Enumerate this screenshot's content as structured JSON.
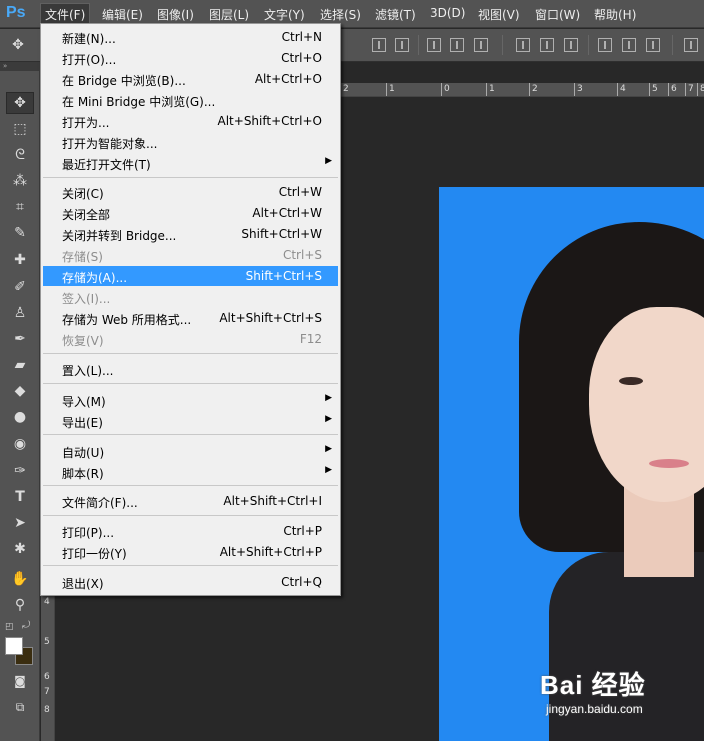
{
  "menubar": {
    "logo": "Ps",
    "items": [
      "文件(F)",
      "编辑(E)",
      "图像(I)",
      "图层(L)",
      "文字(Y)",
      "选择(S)",
      "滤镜(T)",
      "3D(D)",
      "视图(V)",
      "窗口(W)",
      "帮助(H)"
    ]
  },
  "toolbar": {
    "collapse": "»",
    "tools": [
      "move-tool",
      "marquee-tool",
      "lasso-tool",
      "magic-wand-tool",
      "crop-tool",
      "eyedropper-tool",
      "healing-brush-tool",
      "brush-tool",
      "clone-stamp-tool",
      "history-brush-tool",
      "eraser-tool",
      "paint-bucket-tool",
      "blur-tool",
      "dodge-tool",
      "pen-tool",
      "type-tool",
      "path-selection-tool",
      "shape-tool",
      "hand-tool",
      "zoom-tool"
    ],
    "foreground_color": "#ffffff",
    "background_color": "#3a2d10"
  },
  "rulers": {
    "top": [
      "2",
      "1",
      "0",
      "1",
      "2",
      "3",
      "4",
      "5",
      "6",
      "7",
      "8"
    ],
    "left": [
      "4",
      "5",
      "6",
      "7",
      "8"
    ]
  },
  "file_menu": {
    "items": [
      {
        "label": "新建(N)...",
        "shortcut": "Ctrl+N"
      },
      {
        "label": "打开(O)...",
        "shortcut": "Ctrl+O"
      },
      {
        "label": "在 Bridge 中浏览(B)...",
        "shortcut": "Alt+Ctrl+O"
      },
      {
        "label": "在 Mini Bridge 中浏览(G)...",
        "shortcut": ""
      },
      {
        "label": "打开为...",
        "shortcut": "Alt+Shift+Ctrl+O"
      },
      {
        "label": "打开为智能对象...",
        "shortcut": ""
      },
      {
        "label": "最近打开文件(T)",
        "shortcut": "",
        "submenu": true
      },
      {
        "label": "关闭(C)",
        "shortcut": "Ctrl+W"
      },
      {
        "label": "关闭全部",
        "shortcut": "Alt+Ctrl+W"
      },
      {
        "label": "关闭并转到 Bridge...",
        "shortcut": "Shift+Ctrl+W"
      },
      {
        "label": "存储(S)",
        "shortcut": "Ctrl+S",
        "disabled": true
      },
      {
        "label": "存储为(A)...",
        "shortcut": "Shift+Ctrl+S",
        "highlighted": true
      },
      {
        "label": "签入(I)...",
        "shortcut": "",
        "disabled": true
      },
      {
        "label": "存储为 Web 所用格式...",
        "shortcut": "Alt+Shift+Ctrl+S"
      },
      {
        "label": "恢复(V)",
        "shortcut": "F12",
        "disabled": true
      },
      {
        "label": "置入(L)...",
        "shortcut": ""
      },
      {
        "label": "导入(M)",
        "shortcut": "",
        "submenu": true
      },
      {
        "label": "导出(E)",
        "shortcut": "",
        "submenu": true
      },
      {
        "label": "自动(U)",
        "shortcut": "",
        "submenu": true
      },
      {
        "label": "脚本(R)",
        "shortcut": "",
        "submenu": true
      },
      {
        "label": "文件简介(F)...",
        "shortcut": "Alt+Shift+Ctrl+I"
      },
      {
        "label": "打印(P)...",
        "shortcut": "Ctrl+P"
      },
      {
        "label": "打印一份(Y)",
        "shortcut": "Alt+Shift+Ctrl+P"
      },
      {
        "label": "退出(X)",
        "shortcut": "Ctrl+Q"
      }
    ]
  },
  "canvas": {
    "background_color": "#2389f2"
  },
  "watermark": {
    "main": "Bai 经验",
    "sub": "jingyan.baidu.com"
  }
}
